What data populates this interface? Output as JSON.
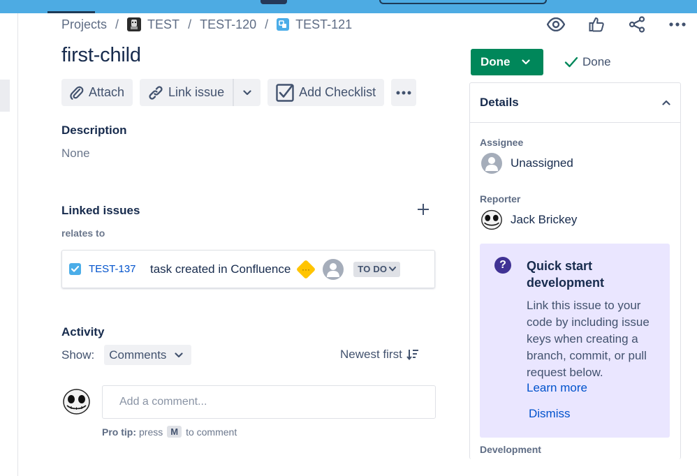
{
  "breadcrumbs": {
    "projects": "Projects",
    "project": "TEST",
    "parent": "TEST-120",
    "current": "TEST-121",
    "separator": "/"
  },
  "issue": {
    "title": "first-child"
  },
  "toolbar": {
    "attach": "Attach",
    "link_issue": "Link issue",
    "add_checklist": "Add Checklist"
  },
  "description": {
    "heading": "Description",
    "value": "None"
  },
  "linked_issues": {
    "heading": "Linked issues",
    "relation": "relates to",
    "items": [
      {
        "key": "TEST-137",
        "summary": "task created in Confluence",
        "status": "TO DO",
        "priority_icon": "medium-priority-icon",
        "assignee_icon": "unassigned-avatar-icon"
      }
    ]
  },
  "activity": {
    "heading": "Activity",
    "show_label": "Show:",
    "show_value": "Comments",
    "sort_label": "Newest first",
    "comment_placeholder": "Add a comment...",
    "protip_bold": "Pro tip:",
    "protip_press": "press",
    "protip_key": "M",
    "protip_rest": "to comment"
  },
  "status": {
    "button": "Done",
    "resolution": "Done"
  },
  "details": {
    "heading": "Details",
    "assignee_label": "Assignee",
    "assignee_value": "Unassigned",
    "reporter_label": "Reporter",
    "reporter_value": "Jack Brickey",
    "development_label": "Development"
  },
  "quick_start": {
    "title": "Quick start development",
    "body": "Link this issue to your code by including issue keys when creating a branch, commit, or pull request below.",
    "learn_more": "Learn more",
    "dismiss": "Dismiss"
  },
  "colors": {
    "topbar": "#4dabe3",
    "done_green": "#00875a",
    "link_blue": "#0052cc",
    "quick_start_bg": "#eae6ff",
    "priority_yellow": "#ffc400"
  }
}
